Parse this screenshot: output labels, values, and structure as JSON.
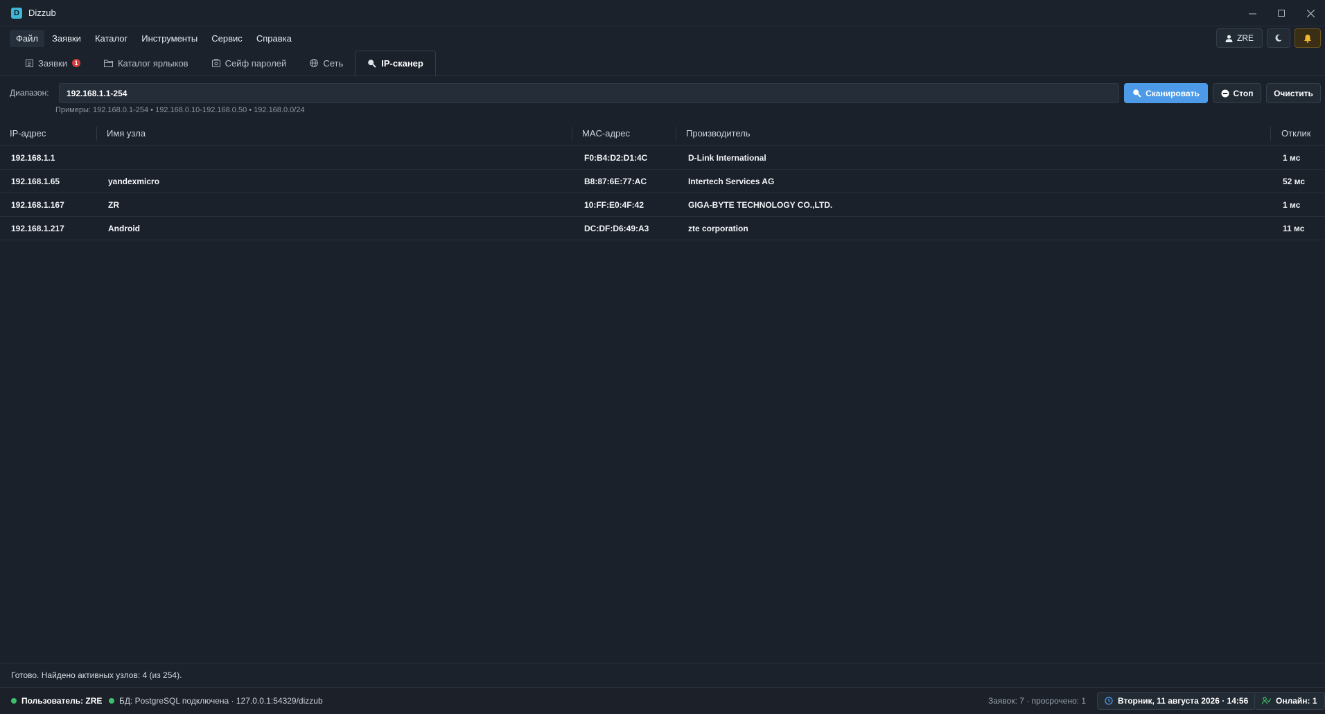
{
  "window": {
    "title": "Dizzub",
    "icon_letter": "D"
  },
  "menu": {
    "items": [
      "Файл",
      "Заявки",
      "Каталог",
      "Инструменты",
      "Сервис",
      "Справка"
    ],
    "user_label": "ZRE"
  },
  "tabs": [
    {
      "label": "Заявки",
      "icon": "clipboard-icon",
      "badge": "1"
    },
    {
      "label": "Каталог ярлыков",
      "icon": "folder-icon"
    },
    {
      "label": "Сейф паролей",
      "icon": "safe-icon"
    },
    {
      "label": "Сеть",
      "icon": "globe-icon"
    },
    {
      "label": "IP-сканер",
      "icon": "search-icon",
      "active": true
    }
  ],
  "scanner": {
    "range_label": "Диапазон:",
    "range_value": "192.168.1.1-254",
    "scan_label": "Сканировать",
    "stop_label": "Стоп",
    "clear_label": "Очистить",
    "examples": "Примеры: 192.168.0.1-254  •  192.168.0.10-192.168.0.50  •  192.168.0.0/24"
  },
  "table": {
    "headers": [
      "IP-адрес",
      "Имя узла",
      "MAC-адрес",
      "Производитель",
      "Отклик"
    ],
    "rows": [
      {
        "ip": "192.168.1.1",
        "host": "",
        "mac": "F0:B4:D2:D1:4C",
        "vendor": "D-Link International",
        "ping": "1 мс"
      },
      {
        "ip": "192.168.1.65",
        "host": "yandexmicro",
        "mac": "B8:87:6E:77:AC",
        "vendor": "Intertech Services AG",
        "ping": "52 мс"
      },
      {
        "ip": "192.168.1.167",
        "host": "ZR",
        "mac": "10:FF:E0:4F:42",
        "vendor": "GIGA-BYTE TECHNOLOGY CO.,LTD.",
        "ping": "1 мс"
      },
      {
        "ip": "192.168.1.217",
        "host": "Android",
        "mac": "DC:DF:D6:49:A3",
        "vendor": "zte corporation",
        "ping": "11 мс"
      }
    ]
  },
  "status": {
    "text": "Готово. Найдено активных узлов: 4 (из 254)."
  },
  "footer": {
    "user": "Пользователь: ZRE",
    "db": "БД: PostgreSQL подключена · 127.0.0.1:54329/dizzub",
    "tickets": "Заявок: 7 · просрочено: 1",
    "datetime": "Вторник, 11 августа 2026 · 14:56",
    "online": "Онлайн: 1"
  },
  "colors": {
    "accent": "#4d9be8",
    "online": "#3ec16a",
    "badge": "#d43b3b",
    "bell": "#f2b733"
  }
}
